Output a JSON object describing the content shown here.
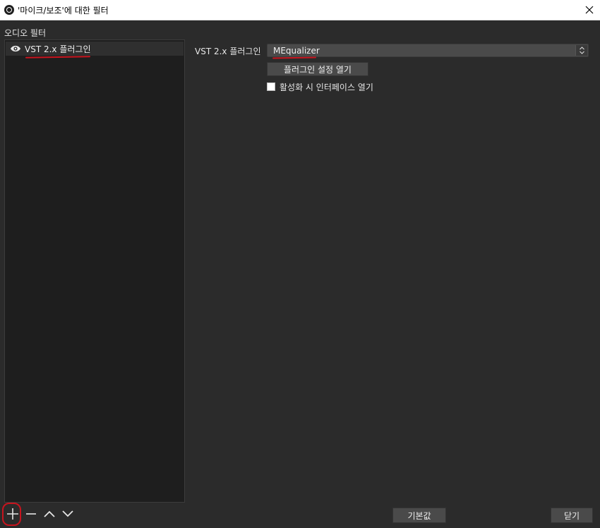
{
  "window": {
    "title": "'마이크/보조'에 대한 필터",
    "app_icon": "obs-logo-icon",
    "close_icon": "close-icon"
  },
  "filters": {
    "section_label": "오디오 필터",
    "items": [
      {
        "name": "VST 2.x 플러그인",
        "icon": "eye-icon",
        "selected": true
      }
    ]
  },
  "properties": {
    "plugin_label": "VST 2.x 플러그인",
    "plugin_value": "MEqualizer",
    "open_settings_label": "플러그인 설정 열기",
    "open_on_activate_label": "활성화 시 인터페이스 열기",
    "open_on_activate_checked": false
  },
  "toolbar": {
    "add_icon": "plus-icon",
    "remove_icon": "minus-icon",
    "move_up_icon": "chevron-up-icon",
    "move_down_icon": "chevron-down-icon"
  },
  "footer": {
    "defaults_label": "기본값",
    "close_label": "닫기"
  },
  "colors": {
    "annotation_red": "#c8141e",
    "background": "#2b2b2b",
    "list_background": "#1e1e1e"
  }
}
